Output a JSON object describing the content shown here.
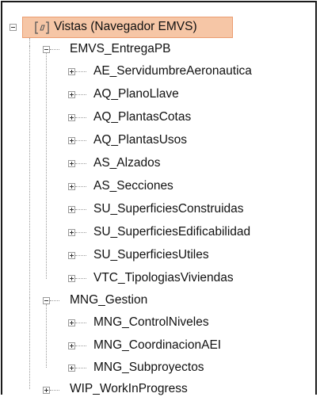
{
  "tree": {
    "root": {
      "label": "Vistas (Navegador EMVS)",
      "icon": "view-brackets-icon"
    },
    "groups": [
      {
        "label": "EMVS_EntregaPB",
        "expanded": true,
        "children": [
          "AE_ServidumbreAeronautica",
          "AQ_PlanoLlave",
          "AQ_PlantasCotas",
          "AQ_PlantasUsos",
          "AS_Alzados",
          "AS_Secciones",
          "SU_SuperficiesConstruidas",
          "SU_SuperficiesEdificabilidad",
          "SU_SuperficiesUtiles",
          "VTC_TipologiasViviendas"
        ]
      },
      {
        "label": "MNG_Gestion",
        "expanded": true,
        "children": [
          "MNG_ControlNiveles",
          "MNG_CoordinacionAEI",
          "MNG_Subproyectos"
        ]
      },
      {
        "label": "WIP_WorkInProgress",
        "expanded": false,
        "children": []
      }
    ]
  },
  "colors": {
    "selection_bg": "#f6c6a6",
    "selection_border": "#eb9d71"
  }
}
